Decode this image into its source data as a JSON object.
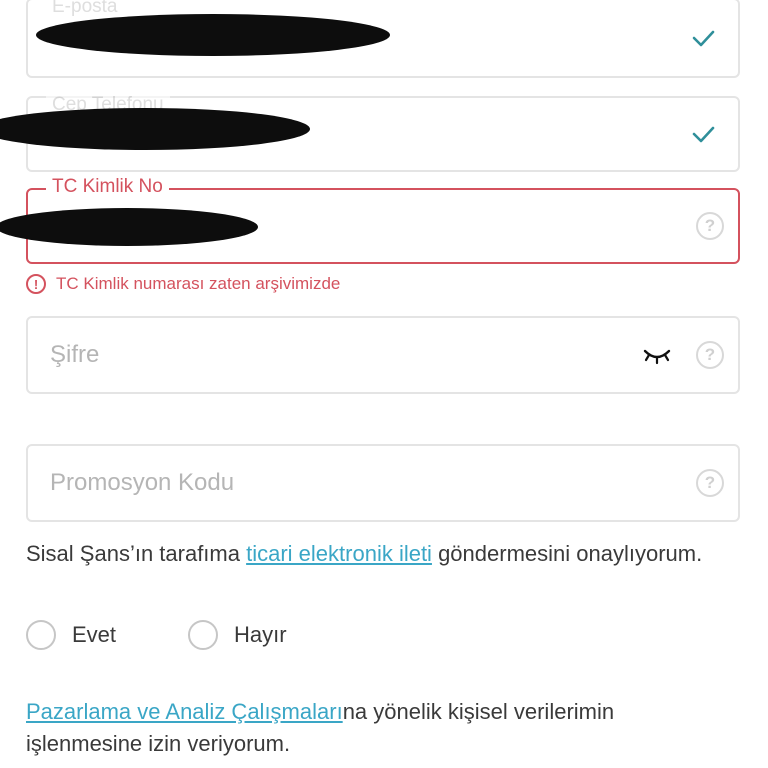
{
  "form": {
    "email": {
      "label": "E-posta",
      "valid": true
    },
    "phone": {
      "label": "Cep Telefonu",
      "valid": true
    },
    "tc": {
      "label": "TC Kimlik No",
      "error": "TC Kimlik numarası zaten arşivimizde"
    },
    "password": {
      "placeholder": "Şifre"
    },
    "promo": {
      "placeholder": "Promosyon Kodu"
    }
  },
  "consent_commercial": {
    "text_before": "Sisal Şans’ın tarafıma ",
    "link": "ticari elektronik ileti",
    "text_after": " göndermesini onaylıyorum.",
    "options": [
      "Evet",
      "Hayır"
    ]
  },
  "consent_marketing": {
    "link": "Pazarlama ve Analiz Çalışmaları",
    "text_after": "na yönelik kişisel verilerimin işlenmesine izin veriyorum."
  },
  "colors": {
    "error": "#d4525e",
    "link": "#3aa6c6",
    "check": "#2f8f9a"
  },
  "icons": {
    "valid": "check-icon",
    "help": "question-circle-icon",
    "password_toggle": "eye-closed-icon",
    "error": "exclamation-circle-icon"
  }
}
